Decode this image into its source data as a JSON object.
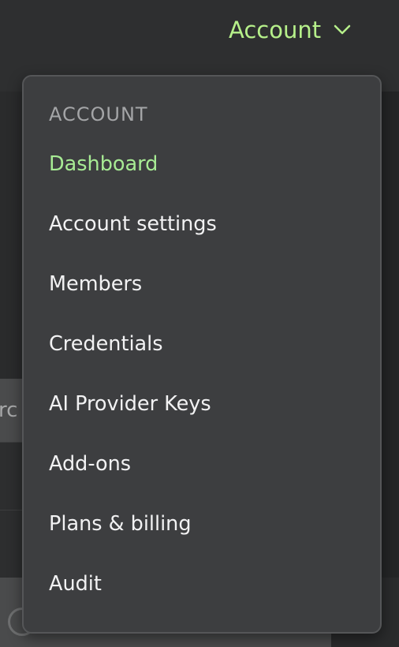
{
  "topbar": {
    "account_label": "Account",
    "account_icon": "chevron-down-icon"
  },
  "background": {
    "search_text": "rc"
  },
  "menu": {
    "heading": "ACCOUNT",
    "items": [
      {
        "label": "Dashboard",
        "active": true
      },
      {
        "label": "Account settings",
        "active": false
      },
      {
        "label": "Members",
        "active": false
      },
      {
        "label": "Credentials",
        "active": false
      },
      {
        "label": "AI Provider Keys",
        "active": false
      },
      {
        "label": "Add-ons",
        "active": false
      },
      {
        "label": "Plans & billing",
        "active": false
      },
      {
        "label": "Audit",
        "active": false
      }
    ]
  },
  "colors": {
    "accent_green": "#b6f08a",
    "active_item": "#a7eb94",
    "menu_bg": "#3d3e40",
    "page_bg": "#242526"
  }
}
